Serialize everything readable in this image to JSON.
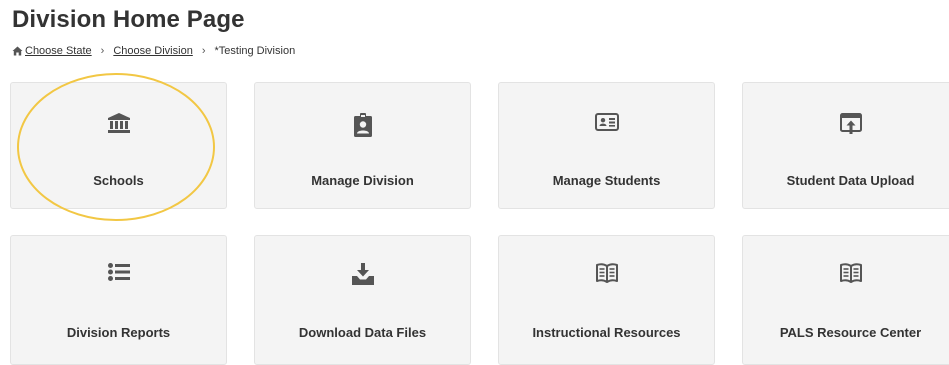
{
  "page": {
    "title": "Division Home Page"
  },
  "breadcrumb": {
    "items": [
      {
        "label": "Choose State"
      },
      {
        "label": "Choose Division"
      },
      {
        "label": "*Testing Division"
      }
    ],
    "separator": "›",
    "home_icon": "home-icon"
  },
  "tiles": [
    {
      "label": "Schools",
      "icon": "bank-icon"
    },
    {
      "label": "Manage Division",
      "icon": "id-badge-icon"
    },
    {
      "label": "Manage Students",
      "icon": "id-card-icon"
    },
    {
      "label": "Student Data Upload",
      "icon": "upload-window-icon"
    },
    {
      "label": "Division Reports",
      "icon": "list-icon"
    },
    {
      "label": "Download Data Files",
      "icon": "download-tray-icon"
    },
    {
      "label": "Instructional Resources",
      "icon": "open-book-icon"
    },
    {
      "label": "PALS Resource Center",
      "icon": "open-book-icon"
    }
  ],
  "annotation": {
    "highlight_color": "#f2c744",
    "highlighted_tile": "Schools"
  },
  "colors": {
    "tile_background": "#f4f4f4",
    "tile_border": "#e3e3e3",
    "icon_color": "#555555",
    "text_color": "#333333"
  }
}
